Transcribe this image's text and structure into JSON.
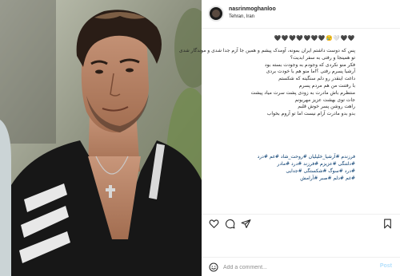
{
  "post": {
    "username": "nasrinmoghanloo",
    "location": "Tehran, Iran",
    "emoji_row": "🖤🖤🖤🖤🖤🖤🖤😢🤍🖤🖤",
    "caption_lines": [
      "پس که دوست داشتم ایران بمونه، آومدک پیشم و همین جا آزم جدا شدی و موندگار شدی",
      "تو همینجا و رفتی به سفر ابدیت؟",
      "فکر منو نکردی که وجودم به وجودت بسته بود",
      "آرشیا پسرم رفتی ؟اما منو هم با خودت بردی",
      "داغت اینقدر رو دلم سنگینه که شکستم",
      "با رفتنت من هم مردم پسرم",
      "منتظرم باش مادرت به زودی پشت سرت میاد پیشت",
      "جات توی بهشت عزیز مهربونم",
      "راهت روشن پسر خوش قلبم",
      "بدو بدو مادرت آرام نیست اما تو آروم بخواب"
    ],
    "hashtag_lines": [
      "فرزندم #آرشیا_خلیلیان #روحت_شاد #غم #درد",
      "#دلتنگی #عزیزم #فرزند #درد #مادر",
      "#درد #سوگ #شکستگی #جدایی",
      "#غم #دلم #صبر #آرامش"
    ]
  },
  "actions": {
    "like_icon": "heart-icon",
    "comment_icon": "comment-icon",
    "share_icon": "paper-plane-icon",
    "save_icon": "bookmark-icon"
  },
  "comment": {
    "placeholder": "Add a comment...",
    "post_label": "Post",
    "emoji_icon": "smile-icon"
  },
  "colors": {
    "hashtag": "#00376b",
    "post_button_disabled": "#b2dffc",
    "text": "#262626",
    "muted": "#8e8e8e"
  }
}
